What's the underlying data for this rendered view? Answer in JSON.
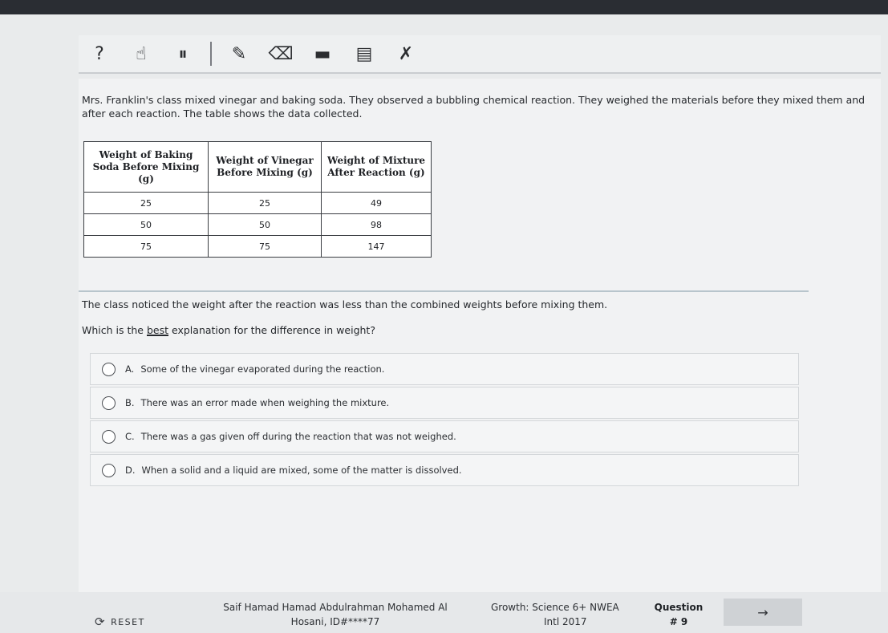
{
  "toolbar": {
    "tools": [
      {
        "icon": "help-icon",
        "glyph": "?"
      },
      {
        "icon": "pointer-hand-icon",
        "glyph": "☝"
      },
      {
        "icon": "pause-icon",
        "glyph": "⏸"
      },
      {
        "icon": "pen-icon",
        "glyph": "✎"
      },
      {
        "icon": "eraser-icon",
        "glyph": "⌫"
      },
      {
        "icon": "highlighter-icon",
        "glyph": "▬"
      },
      {
        "icon": "notepad-icon",
        "glyph": "▤"
      },
      {
        "icon": "answer-eliminator-icon",
        "glyph": "✗"
      }
    ]
  },
  "stem": "Mrs. Franklin's class mixed vinegar and baking soda. They observed a bubbling chemical reaction. They weighed the materials before they mixed them and after each reaction. The table shows the data collected.",
  "table": {
    "headers": [
      "Weight of Baking Soda Before Mixing (g)",
      "Weight of Vinegar Before Mixing (g)",
      "Weight of Mixture After Reaction (g)"
    ],
    "rows": [
      [
        "25",
        "25",
        "49"
      ],
      [
        "50",
        "50",
        "98"
      ],
      [
        "75",
        "75",
        "147"
      ]
    ]
  },
  "notice": "The class noticed the weight after the reaction was less than the combined weights before mixing them.",
  "question": {
    "before": "Which is the ",
    "emphasis": "best",
    "after": " explanation for the difference in weight?"
  },
  "choices": [
    {
      "letter": "A.",
      "text": "Some of the vinegar evaporated during the reaction."
    },
    {
      "letter": "B.",
      "text": "There was an error made when weighing the mixture."
    },
    {
      "letter": "C.",
      "text": "There was a gas given off during the reaction that was not weighed."
    },
    {
      "letter": "D.",
      "text": "When a solid and a liquid are mixed, some of the matter is dissolved."
    }
  ],
  "footer": {
    "reset_label": "RESET",
    "student_name": "Saif Hamad Hamad Abdulrahman Mohamed Al",
    "student_line2": "Hosani, ID#****77",
    "test_line1": "Growth: Science 6+ NWEA",
    "test_line2": "Intl 2017",
    "question_label": "Question",
    "question_number": "# 9",
    "next_glyph": "→"
  },
  "colors": {
    "background": "#f1f2f3",
    "text": "#25282c",
    "divider": "#b8c5cc"
  }
}
